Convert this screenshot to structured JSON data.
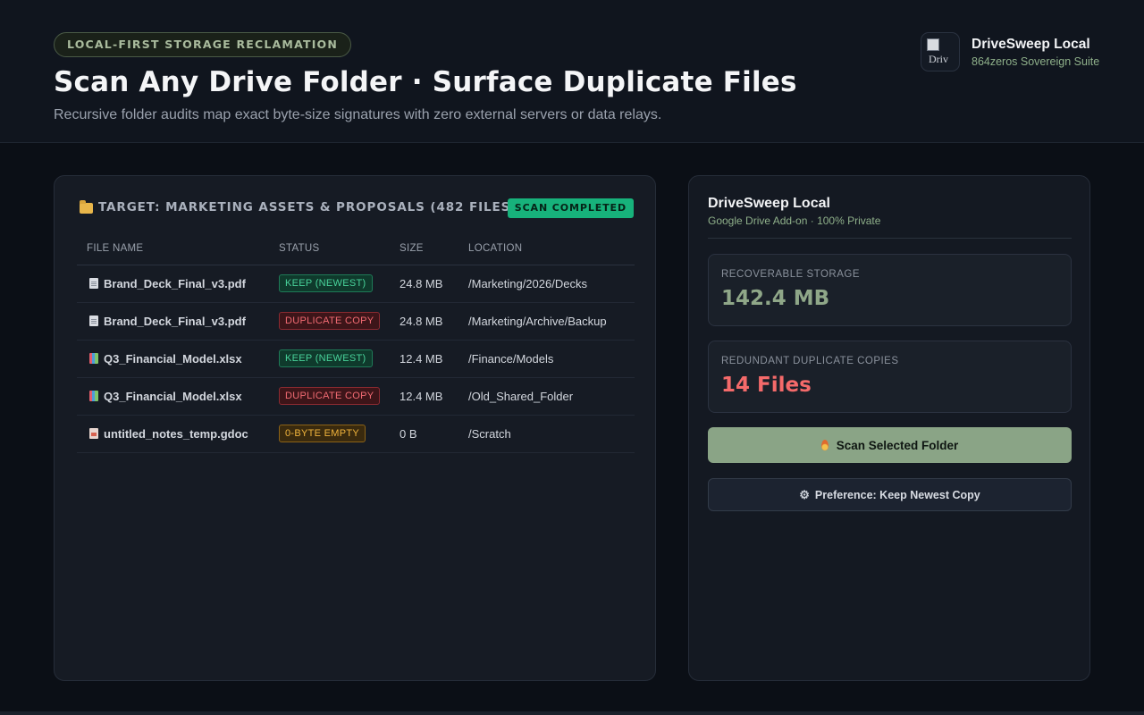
{
  "header": {
    "pill": "LOCAL-FIRST STORAGE RECLAMATION",
    "title": "Scan Any Drive Folder · Surface Duplicate Files",
    "subtitle": "Recursive folder audits map exact byte-size signatures with zero external servers or data relays.",
    "brand": {
      "logo_alt": "Driv",
      "name": "DriveSweep Local",
      "suite": "864zeros Sovereign Suite"
    }
  },
  "scan_panel": {
    "folder_icon": "folder-icon",
    "title": "TARGET: MARKETING ASSETS & PROPOSALS (482 FILES)",
    "status_badge": "SCAN COMPLETED",
    "columns": [
      "FILE NAME",
      "STATUS",
      "SIZE",
      "LOCATION"
    ],
    "rows": [
      {
        "icon": "pdf-file-icon",
        "name": "Brand_Deck_Final_v3.pdf",
        "status": "KEEP (NEWEST)",
        "status_kind": "keep",
        "size": "24.8 MB",
        "location": "/Marketing/2026/Decks"
      },
      {
        "icon": "pdf-file-icon",
        "name": "Brand_Deck_Final_v3.pdf",
        "status": "DUPLICATE COPY",
        "status_kind": "dup",
        "size": "24.8 MB",
        "location": "/Marketing/Archive/Backup"
      },
      {
        "icon": "spreadsheet-file-icon",
        "name": "Q3_Financial_Model.xlsx",
        "status": "KEEP (NEWEST)",
        "status_kind": "keep",
        "size": "12.4 MB",
        "location": "/Finance/Models"
      },
      {
        "icon": "spreadsheet-file-icon",
        "name": "Q3_Financial_Model.xlsx",
        "status": "DUPLICATE COPY",
        "status_kind": "dup",
        "size": "12.4 MB",
        "location": "/Old_Shared_Folder"
      },
      {
        "icon": "doc-file-icon",
        "name": "untitled_notes_temp.gdoc",
        "status": "0-BYTE EMPTY",
        "status_kind": "empty",
        "size": "0 B",
        "location": "/Scratch"
      }
    ]
  },
  "sidebar": {
    "name": "DriveSweep Local",
    "subtitle": "Google Drive Add-on · 100% Private",
    "stats": [
      {
        "label": "RECOVERABLE STORAGE",
        "value": "142.4 MB"
      },
      {
        "label": "REDUNDANT DUPLICATE COPIES",
        "value": "14 Files"
      }
    ],
    "scan_button": "Scan Selected Folder",
    "preference_button": "Preference: Keep Newest Copy"
  },
  "colors": {
    "accent_sage": "#8aa486",
    "keep_green": "#49d39b",
    "duplicate_red": "#f16b73",
    "empty_amber": "#f1b43c",
    "badge_green": "#17b27b"
  }
}
